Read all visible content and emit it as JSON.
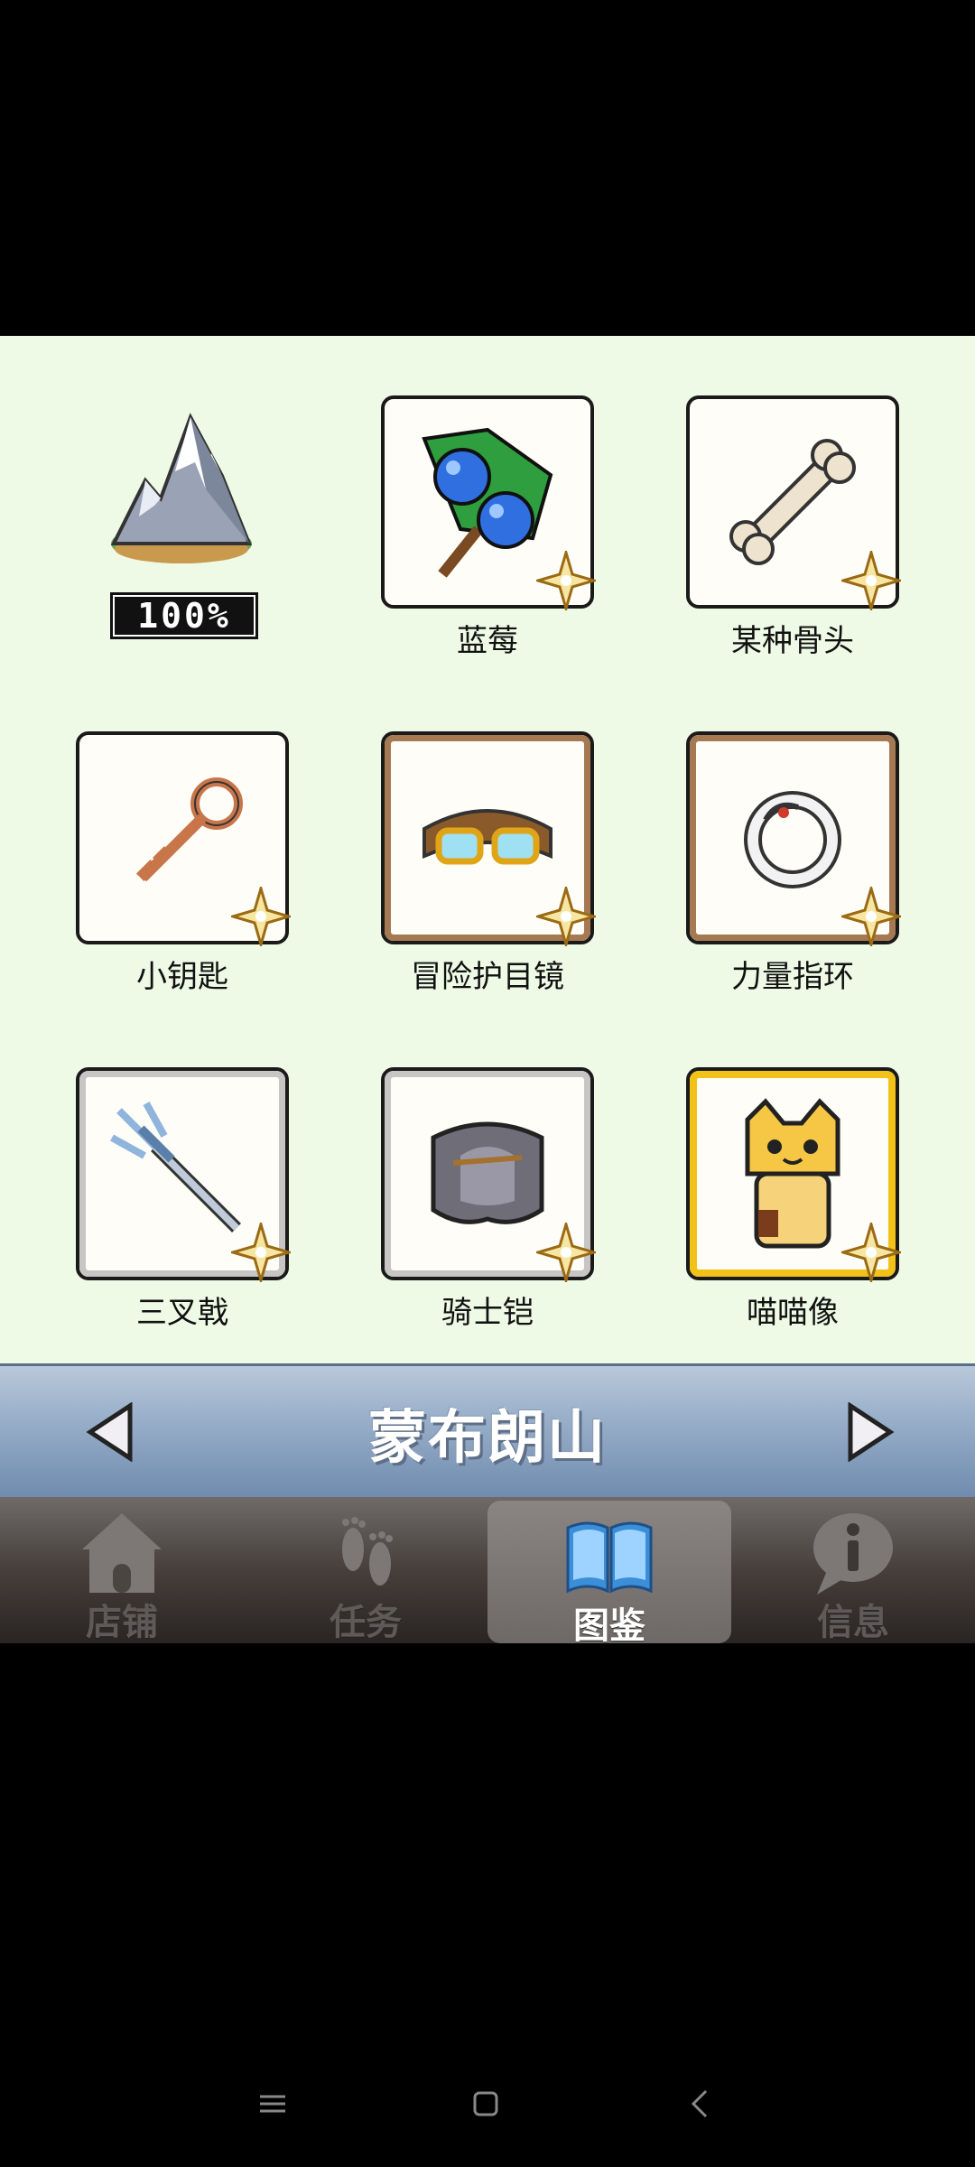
{
  "location": {
    "completion": "100%"
  },
  "items": [
    {
      "label": "蓝莓",
      "icon": "blueberry-icon",
      "frame": "plain"
    },
    {
      "label": "某种骨头",
      "icon": "bone-icon",
      "frame": "plain"
    },
    {
      "label": "小钥匙",
      "icon": "key-icon",
      "frame": "plain"
    },
    {
      "label": "冒险护目镜",
      "icon": "goggles-icon",
      "frame": "brown"
    },
    {
      "label": "力量指环",
      "icon": "ring-icon",
      "frame": "brown"
    },
    {
      "label": "三叉戟",
      "icon": "trident-icon",
      "frame": "gray"
    },
    {
      "label": "骑士铠",
      "icon": "armor-icon",
      "frame": "gray"
    },
    {
      "label": "喵喵像",
      "icon": "cat-statue-icon",
      "frame": "gold"
    }
  ],
  "region": {
    "name": "蒙布朗山"
  },
  "tabs": [
    {
      "label": "店铺",
      "icon": "house-icon"
    },
    {
      "label": "任务",
      "icon": "footprints-icon"
    },
    {
      "label": "图鉴",
      "icon": "book-icon",
      "active": true
    },
    {
      "label": "信息",
      "icon": "info-bubble-icon"
    }
  ],
  "colors": {
    "grid_bg": "#eefae6",
    "gold_frame": "#f2c218",
    "brown_frame": "#a57a52",
    "gray_frame": "#c8c6c4"
  }
}
